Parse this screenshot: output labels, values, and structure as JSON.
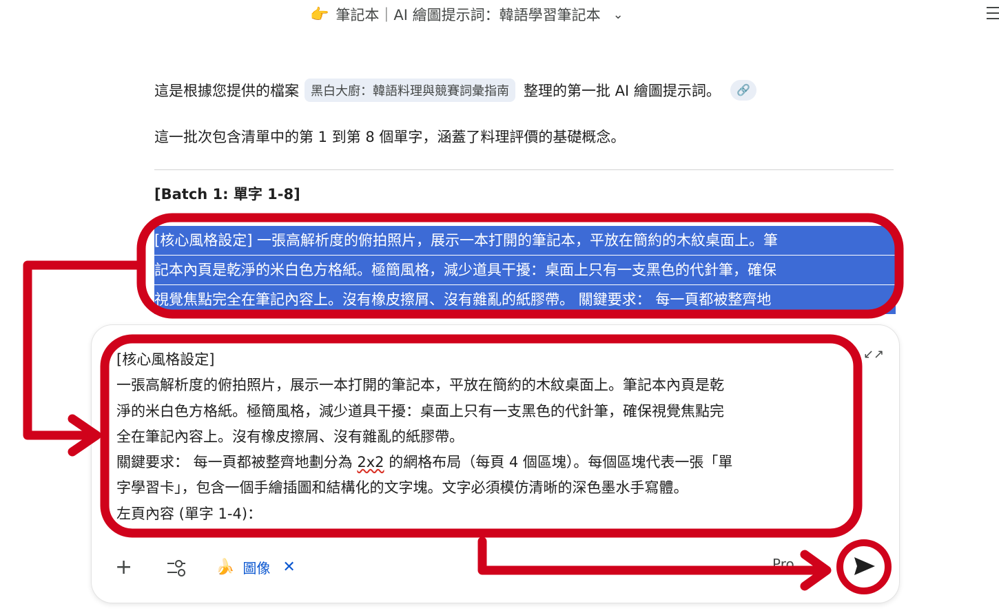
{
  "header": {
    "title_emoji": "👉",
    "title": "筆記本｜AI 繪圖提示詞：韓語學習筆記本",
    "dropdown_icon": "chevron-down-icon"
  },
  "message": {
    "intro_before": "這是根據您提供的檔案",
    "source_chip": "黑白大廚：韓語料理與競賽詞彙指南",
    "intro_after": "整理的第一批 AI 繪圖提示詞。",
    "line2": "這一批次包含清單中的第 1 到第 8 個單字，涵蓋了料理評價的基礎概念。",
    "batch_heading": "[Batch 1: 單字 1-8]",
    "selected_lines": [
      "[核心風格設定] 一張高解析度的俯拍照片，展示一本打開的筆記本，平放在簡約的木紋桌面上。筆",
      "記本內頁是乾淨的米白色方格紙。極簡風格，減少道具干擾：桌面上只有一支黑色的代針筆，確保",
      "視覺焦點完全在筆記內容上。沒有橡皮擦屑、沒有雜亂的紙膠帶。 關鍵要求： 每一頁都被整齊地"
    ]
  },
  "input": {
    "lines": [
      "[核心風格設定]",
      "一張高解析度的俯拍照片，展示一本打開的筆記本，平放在簡約的木紋桌面上。筆記本內頁是乾",
      "淨的米白色方格紙。極簡風格，減少道具干擾：桌面上只有一支黑色的代針筆，確保視覺焦點完",
      "全在筆記內容上。沒有橡皮擦屑、沒有雜亂的紙膠帶。"
    ],
    "line5_before": "關鍵要求： 每一頁都被整齊地劃分為 ",
    "line5_mark": "2x2",
    "line5_after": " 的網格布局（每頁 4 個區塊）。每個區塊代表一張「單",
    "line6": "字學習卡」，包含一個手繪插圖和結構化的文字塊。文字必須模仿清晰的深色墨水手寫體。",
    "line7": "左頁內容 (單字 1-4)："
  },
  "toolbar": {
    "plus": "+",
    "image_chip_label": "圖像",
    "remove": "✕",
    "model_label": "Pro"
  },
  "colors": {
    "annotation_red": "#d0021b",
    "selection_blue": "#3d6bd6",
    "link_blue": "#0b57d0"
  }
}
